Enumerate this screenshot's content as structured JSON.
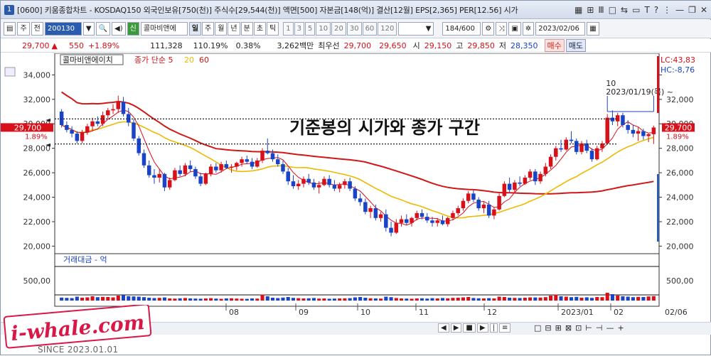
{
  "window": {
    "title_number": "1",
    "title": "[0600] 키움종합차트 - KOSDAQ150 외국인보유[750(천)] 주식수[29,544(천)] 액면[500] 자본금[148(억)] 결산[12월] EPS[2,365] PER[12.56] 시가",
    "controls": [
      "▦",
      "⊞",
      "Ⅲ",
      "□",
      "⇆",
      "▭",
      "T",
      "?",
      "⋮",
      "—",
      "❐",
      "✕"
    ]
  },
  "toolbar": {
    "code": "200130",
    "market_type": "주",
    "prev_label": "전",
    "new_label": "신",
    "stock_name": "콜마비앤에",
    "periods": [
      "일",
      "주",
      "월",
      "년",
      "분",
      "초",
      "틱"
    ],
    "active_period": "일",
    "intervals": [
      "1",
      "3",
      "5",
      "10",
      "20",
      "30",
      "60",
      "120"
    ],
    "count": "184",
    "count_total": "/600",
    "date": "2023/02/06"
  },
  "quote": {
    "price": "29,700",
    "arrow": "▲",
    "change": "550",
    "change_pct": "+1.89%",
    "volume": "111,328",
    "volume_ratio": "110.19%",
    "turnover": "0.38%",
    "amount": "3,262백만",
    "best_label": "최우선",
    "best_ask": "29,700",
    "best_bid": "29,650",
    "open_label": "시",
    "open": "29,150",
    "high_label": "고",
    "high": "29,850",
    "low_label": "저",
    "low": "28,350",
    "buy_label": "매수",
    "sell_label": "매도"
  },
  "chart_data": {
    "type": "candlestick",
    "legend": {
      "name": "콜마비앤에이치",
      "series": "종가 단순",
      "ma5": "5",
      "ma20": "20",
      "ma60": "60"
    },
    "lc": "LC:43,83",
    "hc": "HC:-8,76",
    "current_price": "29,700",
    "current_pct": "1.89%",
    "annotation": {
      "count": "10",
      "date": "2023/01/19(목) ~"
    },
    "overlay_text": "기준봉의 시가와 종가 구간",
    "y_ticks": [
      34000,
      32000,
      30000,
      28000,
      26000,
      24000,
      22000,
      20000
    ],
    "y_tick_labels": [
      "34,000",
      "32,000",
      "30,000",
      "28,000",
      "26,000",
      "24,000",
      "22,000",
      "20,000"
    ],
    "right_tick_labels": [
      "32,000",
      "30,000",
      "28,000",
      "26,000",
      "24,000",
      "22,000",
      "20,000"
    ],
    "ylim": [
      19500,
      35300
    ],
    "hlines": [
      30400,
      28350
    ],
    "x_labels": [
      "08",
      "09",
      "10",
      "11",
      "12",
      "2023/01",
      "02"
    ],
    "right_date": "02/06",
    "volume_title": "거래대금 - 억",
    "volume_tick": "500,00",
    "colors": {
      "up": "#d8101a",
      "down": "#1a44c8",
      "ma5": "#d8101a",
      "ma20": "#f0b800",
      "ma60": "#d01818"
    },
    "candles": [
      [
        31000,
        31200,
        29700,
        29900
      ],
      [
        29900,
        30200,
        29300,
        29500
      ],
      [
        29500,
        29800,
        28900,
        29200
      ],
      [
        29200,
        29400,
        28400,
        28600
      ],
      [
        28600,
        29500,
        28400,
        29300
      ],
      [
        29300,
        30000,
        29100,
        29800
      ],
      [
        29800,
        30500,
        29400,
        30200
      ],
      [
        30200,
        30600,
        29800,
        30000
      ],
      [
        30000,
        31000,
        29800,
        30700
      ],
      [
        30700,
        31300,
        30400,
        31100
      ],
      [
        31100,
        31600,
        30800,
        31200
      ],
      [
        31200,
        32300,
        30900,
        31800
      ],
      [
        31800,
        32200,
        30600,
        30800
      ],
      [
        30800,
        31300,
        29800,
        30100
      ],
      [
        30100,
        30400,
        28600,
        28800
      ],
      [
        28800,
        29000,
        27400,
        27600
      ],
      [
        27600,
        27900,
        26400,
        26600
      ],
      [
        26600,
        27000,
        25600,
        25800
      ],
      [
        25800,
        26300,
        25100,
        25600
      ],
      [
        25600,
        26300,
        25200,
        25900
      ],
      [
        25900,
        26000,
        24500,
        24800
      ],
      [
        24800,
        25600,
        24600,
        25400
      ],
      [
        25400,
        26400,
        25300,
        26200
      ],
      [
        26200,
        26600,
        25700,
        25900
      ],
      [
        25900,
        26800,
        25700,
        26600
      ],
      [
        26600,
        27000,
        26100,
        26300
      ],
      [
        26300,
        26500,
        25500,
        25700
      ],
      [
        25700,
        26000,
        24900,
        25100
      ],
      [
        25100,
        26000,
        25000,
        25900
      ],
      [
        25900,
        26700,
        25700,
        26500
      ],
      [
        26500,
        26800,
        26000,
        26200
      ],
      [
        26200,
        26900,
        26000,
        26700
      ],
      [
        26700,
        27000,
        26300,
        26400
      ],
      [
        26400,
        26700,
        26000,
        26500
      ],
      [
        26500,
        26900,
        26200,
        26800
      ],
      [
        26800,
        27300,
        26500,
        27100
      ],
      [
        27100,
        27400,
        26700,
        26900
      ],
      [
        26900,
        27200,
        26300,
        26500
      ],
      [
        26500,
        27200,
        26400,
        27000
      ],
      [
        27000,
        28000,
        26800,
        27800
      ],
      [
        27800,
        28800,
        27500,
        27600
      ],
      [
        27600,
        27900,
        26900,
        27100
      ],
      [
        27100,
        27500,
        26500,
        26700
      ],
      [
        26700,
        27000,
        25900,
        26100
      ],
      [
        26100,
        26400,
        25000,
        25300
      ],
      [
        25300,
        25800,
        24700,
        24900
      ],
      [
        24900,
        25400,
        24600,
        25100
      ],
      [
        25100,
        25700,
        24800,
        25500
      ],
      [
        25500,
        25900,
        25000,
        25200
      ],
      [
        25200,
        25500,
        24600,
        24800
      ],
      [
        24800,
        25300,
        24300,
        25000
      ],
      [
        25000,
        25700,
        24900,
        25500
      ],
      [
        25500,
        25800,
        24800,
        25000
      ],
      [
        25000,
        25400,
        24500,
        24700
      ],
      [
        24700,
        25200,
        24400,
        25000
      ],
      [
        25000,
        25500,
        24700,
        25300
      ],
      [
        25300,
        25600,
        24500,
        24700
      ],
      [
        24700,
        24900,
        23700,
        23900
      ],
      [
        23900,
        24300,
        23300,
        23600
      ],
      [
        23600,
        23900,
        22600,
        22800
      ],
      [
        22800,
        23300,
        22300,
        23100
      ],
      [
        23100,
        23400,
        22100,
        22300
      ],
      [
        22300,
        22800,
        22000,
        22600
      ],
      [
        22600,
        23000,
        21200,
        21500
      ],
      [
        21500,
        22000,
        20800,
        21100
      ],
      [
        21100,
        22200,
        21000,
        21900
      ],
      [
        21900,
        22500,
        21600,
        22200
      ],
      [
        22200,
        22600,
        21700,
        21900
      ],
      [
        21900,
        22400,
        21600,
        22300
      ],
      [
        22300,
        22900,
        22100,
        22700
      ],
      [
        22700,
        23000,
        22200,
        22400
      ],
      [
        22400,
        22700,
        21900,
        22100
      ],
      [
        22100,
        22400,
        21600,
        21900
      ],
      [
        21900,
        22300,
        21600,
        22100
      ],
      [
        22100,
        22500,
        21700,
        21800
      ],
      [
        21800,
        22400,
        21600,
        22300
      ],
      [
        22300,
        22900,
        22100,
        22700
      ],
      [
        22700,
        23300,
        22500,
        23100
      ],
      [
        23100,
        23900,
        22900,
        23700
      ],
      [
        23700,
        24500,
        23500,
        24300
      ],
      [
        24300,
        24600,
        23600,
        23800
      ],
      [
        23800,
        24000,
        22900,
        23100
      ],
      [
        23100,
        23600,
        22700,
        23400
      ],
      [
        23400,
        23700,
        22300,
        22500
      ],
      [
        22500,
        23200,
        22200,
        23000
      ],
      [
        23000,
        24300,
        22900,
        24100
      ],
      [
        24100,
        25300,
        24000,
        25100
      ],
      [
        25100,
        25600,
        24400,
        24600
      ],
      [
        24600,
        25400,
        24400,
        25200
      ],
      [
        25200,
        25700,
        24900,
        25100
      ],
      [
        25100,
        25800,
        25000,
        25600
      ],
      [
        25600,
        26300,
        25400,
        26100
      ],
      [
        26100,
        26300,
        25000,
        25300
      ],
      [
        25300,
        26100,
        25100,
        25900
      ],
      [
        25900,
        26800,
        25700,
        26500
      ],
      [
        26500,
        27500,
        26300,
        27300
      ],
      [
        27300,
        28200,
        27000,
        28000
      ],
      [
        28000,
        28700,
        27700,
        27900
      ],
      [
        27900,
        28900,
        27800,
        28700
      ],
      [
        28700,
        29400,
        28400,
        28600
      ],
      [
        28600,
        28800,
        27500,
        27700
      ],
      [
        27700,
        28600,
        27500,
        28400
      ],
      [
        28400,
        28700,
        27600,
        27800
      ],
      [
        27800,
        28000,
        26900,
        27100
      ],
      [
        27100,
        28200,
        27000,
        28000
      ],
      [
        28000,
        28600,
        27700,
        28400
      ],
      [
        28400,
        30800,
        28300,
        30500
      ],
      [
        30500,
        31100,
        29900,
        30200
      ],
      [
        30200,
        30900,
        29800,
        30700
      ],
      [
        30700,
        30900,
        29700,
        29900
      ],
      [
        29900,
        30300,
        29200,
        29500
      ],
      [
        29500,
        29900,
        28900,
        29200
      ],
      [
        29200,
        29700,
        28600,
        29400
      ],
      [
        29400,
        29600,
        28700,
        29000
      ],
      [
        29000,
        29200,
        28500,
        29150
      ],
      [
        29150,
        29850,
        28350,
        29700
      ]
    ],
    "volumes": [
      42,
      38,
      35,
      55,
      40,
      45,
      60,
      48,
      52,
      50,
      45,
      70,
      80,
      62,
      58,
      55,
      48,
      40,
      35,
      38,
      44,
      30,
      28,
      32,
      36,
      30,
      28,
      26,
      30,
      34,
      28,
      25,
      30,
      32,
      28,
      26,
      24,
      30,
      28,
      85,
      60,
      40,
      35,
      42,
      50,
      38,
      34,
      30,
      32,
      36,
      28,
      30,
      26,
      28,
      30,
      32,
      34,
      45,
      50,
      40,
      32,
      30,
      28,
      55,
      48,
      36,
      30,
      28,
      26,
      30,
      32,
      28,
      34,
      30,
      36,
      32,
      38,
      40,
      45,
      50,
      36,
      32,
      30,
      34,
      30,
      55,
      50,
      40,
      38,
      36,
      40,
      45,
      44,
      42,
      48,
      70,
      85,
      60,
      55,
      48,
      52,
      40,
      46,
      38,
      50,
      48,
      110,
      90,
      72,
      60,
      55,
      48,
      52,
      50,
      58,
      62
    ]
  },
  "footer": {
    "brand": "i-whale.com",
    "since": "SINCE 2023.01.01"
  },
  "statusbar": {
    "controls": [
      "◀",
      "▶",
      "■",
      "▶",
      "|",
      "≡"
    ],
    "right_tools": [
      "□",
      "⊟",
      "⊞",
      "⊠",
      "⊡",
      "⊢",
      "⊣",
      "—",
      "+"
    ]
  }
}
